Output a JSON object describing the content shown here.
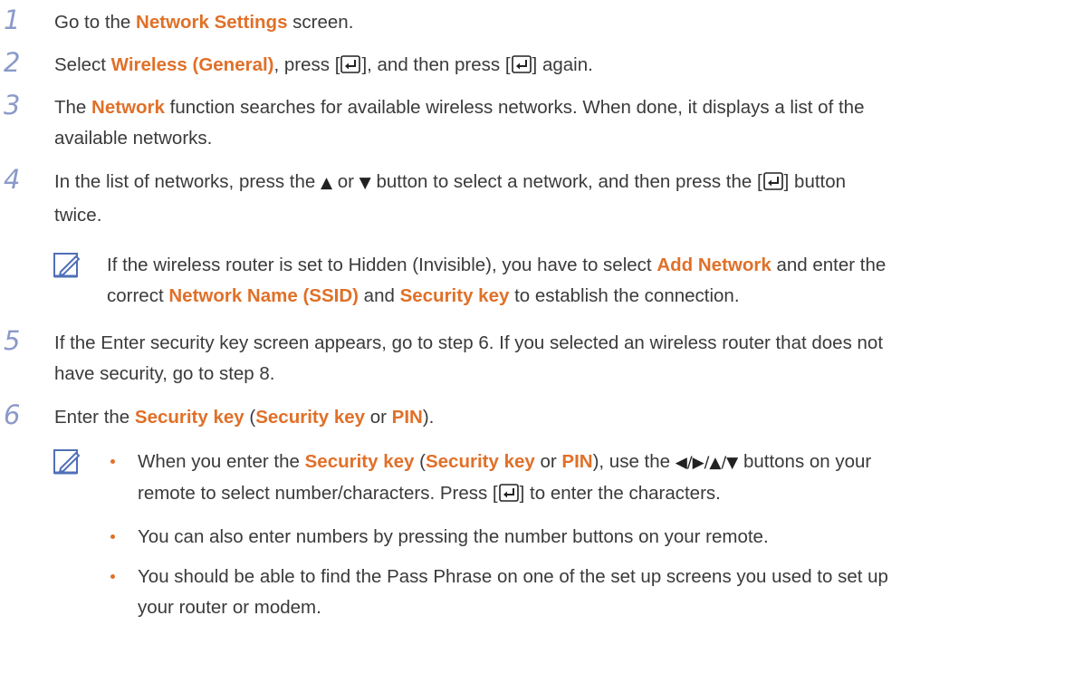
{
  "steps": [
    {
      "num": "1",
      "a": "Go to the ",
      "b": "Network Settings",
      "c": " screen."
    },
    {
      "num": "2",
      "a": "Select ",
      "b": "Wireless (General)",
      "c": ", press [",
      "d": "], and then press [",
      "e": "] again."
    },
    {
      "num": "3",
      "a": "The ",
      "b": "Network",
      "c": " function searches for available wireless networks. When done, it displays a list of the",
      "d": "available networks."
    },
    {
      "num": "4",
      "a": "In the list of networks, press the ",
      "up": "▲",
      "or": " or ",
      "down": "▼",
      "c": " button to select a network, and then press the [",
      "d": "] button",
      "e": "twice."
    },
    {
      "num": "5",
      "a": "If the Enter security key screen appears, go to step 6. If you selected an wireless router that does not",
      "b": "have security, go to step 8."
    },
    {
      "num": "6",
      "a": "Enter the ",
      "b": "Security key",
      "c": " (",
      "d": "Security key",
      "e": " or ",
      "f": "PIN",
      "g": ")."
    }
  ],
  "note1": {
    "a": "If the wireless router is set to Hidden (Invisible), you have to select ",
    "b": "Add Network",
    "c": " and enter the",
    "d": "correct ",
    "e": "Network Name (SSID)",
    "f": " and ",
    "g": "Security key",
    "h": " to establish the connection."
  },
  "note2": {
    "b1": {
      "a": "When you enter the ",
      "b": "Security key",
      "c": " (",
      "d": "Security key",
      "e": " or ",
      "f": "PIN",
      "g": "), use the ",
      "arrows": "◀/▶/▲/▼",
      "h": " buttons on your",
      "i": "remote to select number/characters. Press [",
      "j": "] to enter the characters."
    },
    "b2": "You can also enter numbers by pressing the number buttons on your remote.",
    "b3a": "You should be able to find the Pass Phrase on one of the set up screens you used to set up",
    "b3b": "your router or modem."
  },
  "icons": {
    "enter": "enter-key-icon",
    "note": "note-pencil-icon"
  },
  "colors": {
    "highlight": "#e07028",
    "step_number": "#8a99c8",
    "note_icon": "#4f6fb8"
  }
}
